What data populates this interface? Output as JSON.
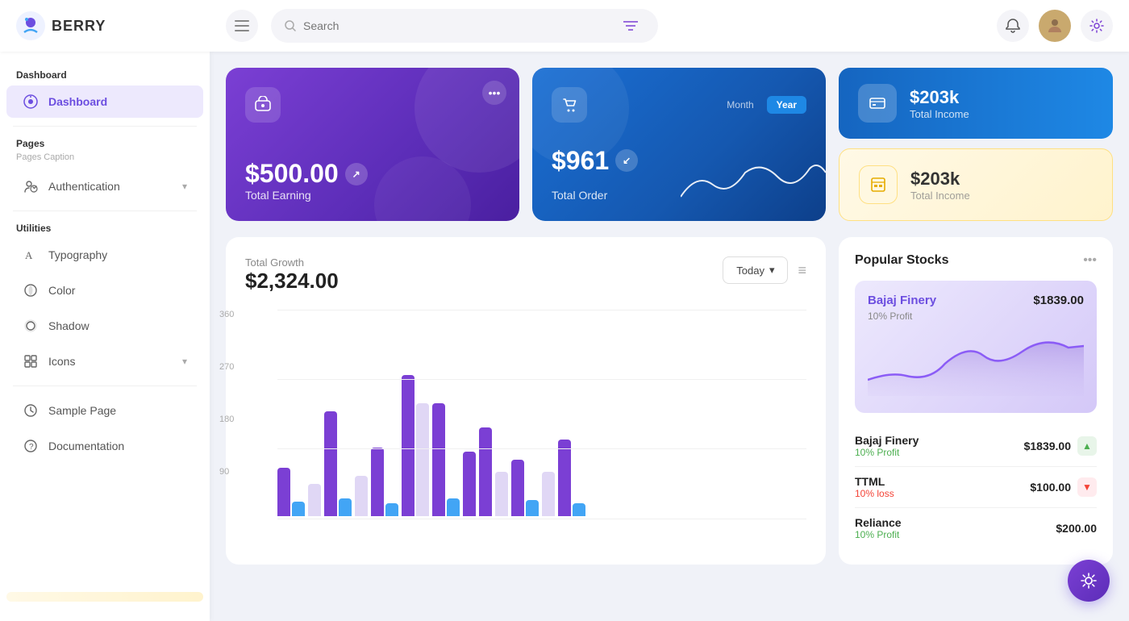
{
  "app": {
    "name": "BERRY"
  },
  "header": {
    "search_placeholder": "Search",
    "hamburger_label": "☰",
    "bell_icon": "🔔",
    "gear_icon": "⚙"
  },
  "sidebar": {
    "dashboard_section": "Dashboard",
    "dashboard_item": "Dashboard",
    "pages_section": "Pages",
    "pages_caption": "Pages Caption",
    "authentication_item": "Authentication",
    "utilities_section": "Utilities",
    "typography_item": "Typography",
    "color_item": "Color",
    "shadow_item": "Shadow",
    "icons_item": "Icons",
    "sample_page_item": "Sample Page",
    "documentation_item": "Documentation"
  },
  "cards": {
    "earning": {
      "amount": "$500.00",
      "label": "Total Earning"
    },
    "order": {
      "amount": "$961",
      "label": "Total Order",
      "period_month": "Month",
      "period_year": "Year"
    },
    "income_blue": {
      "amount": "$203k",
      "label": "Total Income"
    },
    "income_yellow": {
      "amount": "$203k",
      "label": "Total Income"
    }
  },
  "chart": {
    "title": "Total Growth",
    "amount": "$2,324.00",
    "period_btn": "Today",
    "y_labels": [
      "360",
      "270",
      "180",
      "90"
    ],
    "bars": [
      {
        "purple": 60,
        "blue": 20,
        "light": 0
      },
      {
        "purple": 0,
        "blue": 0,
        "light": 40
      },
      {
        "purple": 130,
        "blue": 20,
        "light": 0
      },
      {
        "purple": 0,
        "blue": 0,
        "light": 50
      },
      {
        "purple": 85,
        "blue": 15,
        "light": 0
      },
      {
        "purple": 170,
        "blue": 0,
        "light": 130
      },
      {
        "purple": 140,
        "blue": 20,
        "light": 0
      },
      {
        "purple": 0,
        "blue": 0,
        "light": 0
      },
      {
        "purple": 85,
        "blue": 0,
        "light": 0
      },
      {
        "purple": 0,
        "blue": 0,
        "light": 0
      },
      {
        "purple": 110,
        "blue": 0,
        "light": 0
      },
      {
        "purple": 0,
        "blue": 0,
        "light": 55
      },
      {
        "purple": 75,
        "blue": 20,
        "light": 0
      },
      {
        "purple": 0,
        "blue": 0,
        "light": 0
      },
      {
        "purple": 95,
        "blue": 15,
        "light": 0
      }
    ]
  },
  "stocks": {
    "title": "Popular Stocks",
    "featured": {
      "name": "Bajaj Finery",
      "price": "$1839.00",
      "profit_label": "10% Profit"
    },
    "list": [
      {
        "name": "Bajaj Finery",
        "profit": "10% Profit",
        "profit_type": "up",
        "price": "$1839.00"
      },
      {
        "name": "TTML",
        "profit": "10% loss",
        "profit_type": "down",
        "price": "$100.00"
      },
      {
        "name": "Reliance",
        "profit": "10% Profit",
        "profit_type": "up",
        "price": "$200.00"
      }
    ]
  },
  "fab": {
    "icon": "⚙"
  }
}
